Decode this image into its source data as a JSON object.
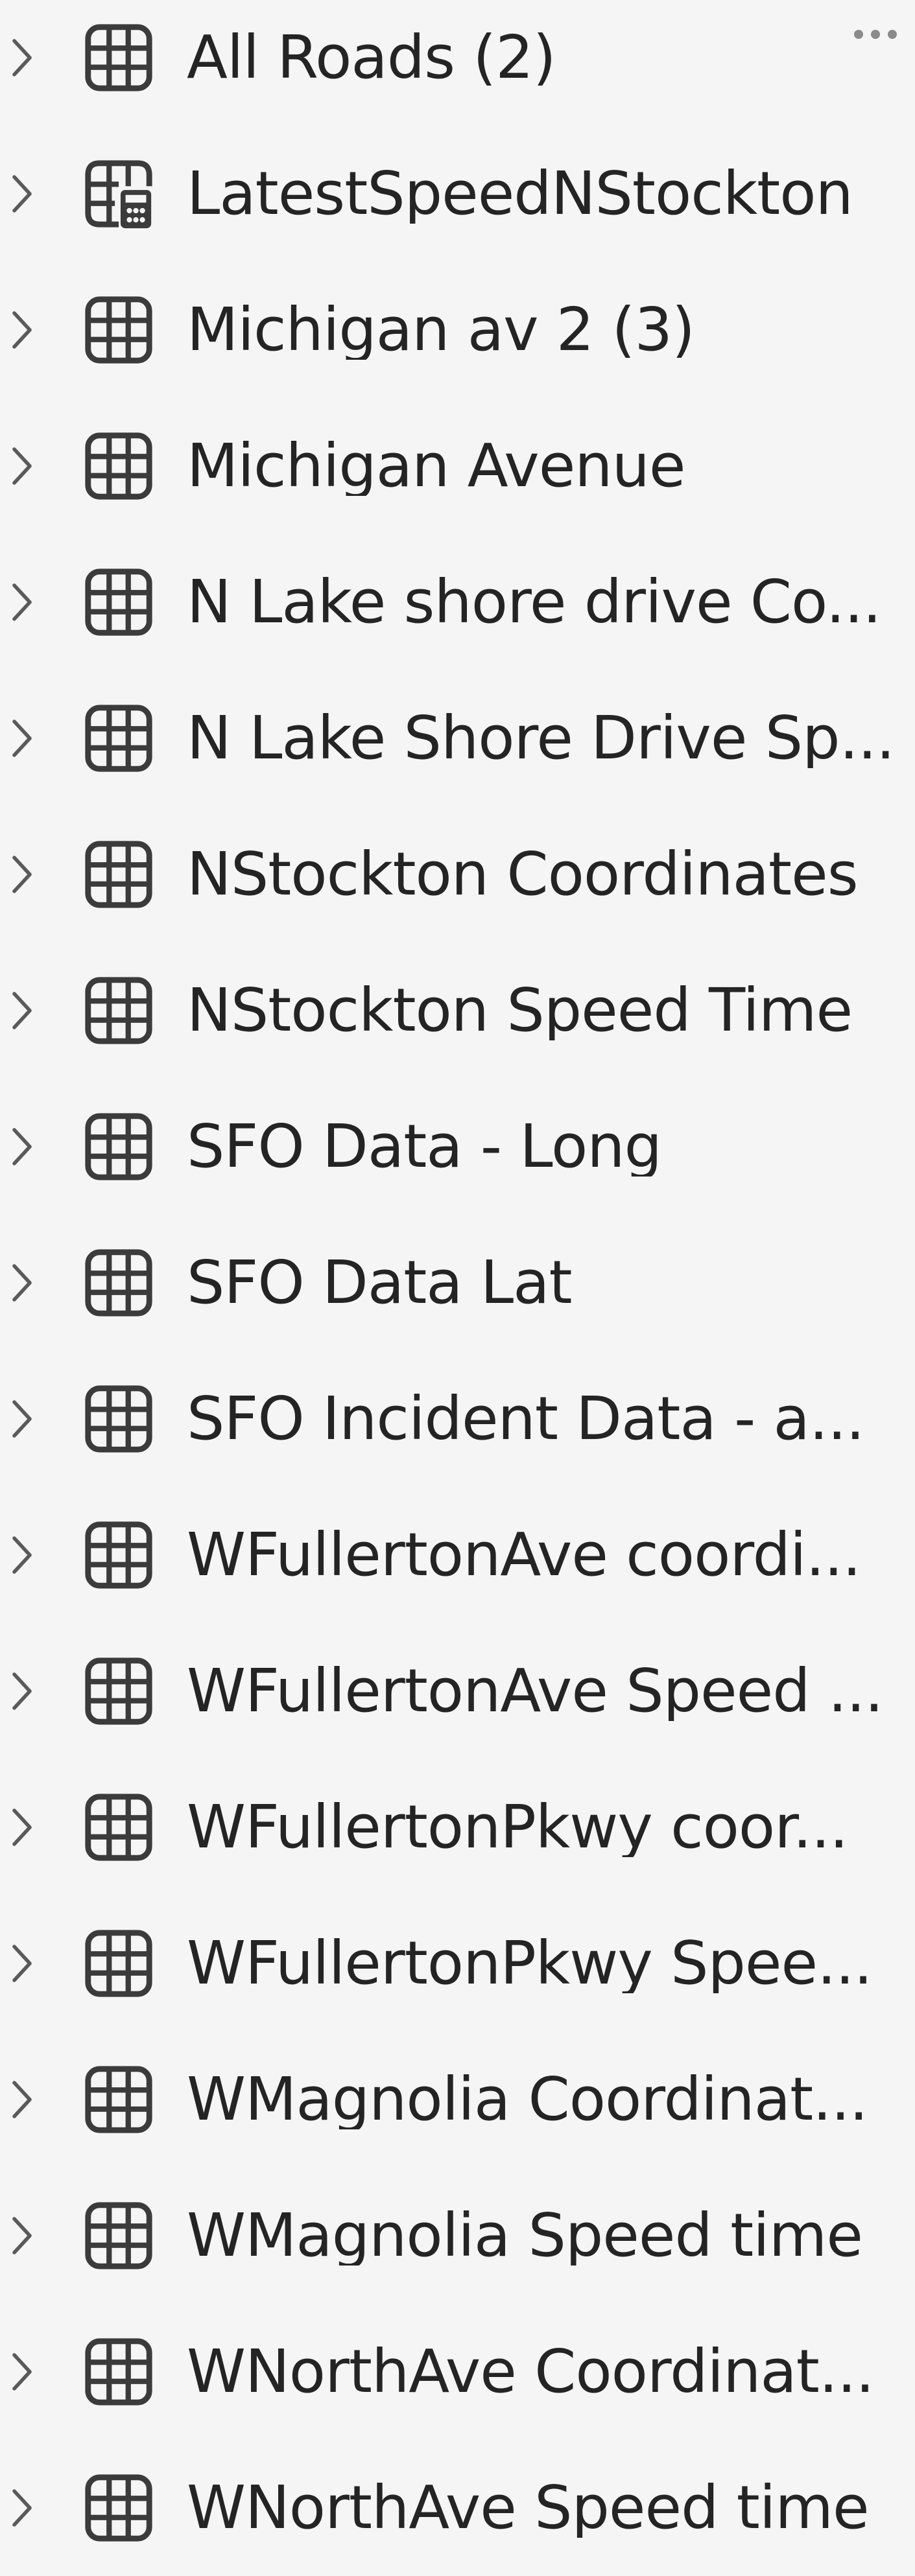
{
  "explorer": {
    "more_menu_label": "...",
    "items": [
      {
        "label": "All Roads (2)",
        "icon": "table-icon"
      },
      {
        "label": "LatestSpeedNStockton",
        "icon": "table-calculator-icon"
      },
      {
        "label": "Michigan av 2 (3)",
        "icon": "table-icon"
      },
      {
        "label": "Michigan Avenue",
        "icon": "table-icon"
      },
      {
        "label": "N Lake shore drive Co...",
        "icon": "table-icon"
      },
      {
        "label": "N Lake Shore Drive Sp...",
        "icon": "table-icon"
      },
      {
        "label": "NStockton Coordinates",
        "icon": "table-icon"
      },
      {
        "label": "NStockton Speed Time",
        "icon": "table-icon"
      },
      {
        "label": "SFO Data - Long",
        "icon": "table-icon"
      },
      {
        "label": "SFO Data Lat",
        "icon": "table-icon"
      },
      {
        "label": "SFO Incident Data - a...",
        "icon": "table-icon"
      },
      {
        "label": "WFullertonAve coordi...",
        "icon": "table-icon"
      },
      {
        "label": "WFullertonAve Speed ...",
        "icon": "table-icon"
      },
      {
        "label": "WFullertonPkwy coor...",
        "icon": "table-icon"
      },
      {
        "label": "WFullertonPkwy Spee...",
        "icon": "table-icon"
      },
      {
        "label": "WMagnolia Coordinat...",
        "icon": "table-icon"
      },
      {
        "label": "WMagnolia Speed time",
        "icon": "table-icon"
      },
      {
        "label": "WNorthAve Coordinat...",
        "icon": "table-icon"
      },
      {
        "label": "WNorthAve Speed time",
        "icon": "table-icon"
      }
    ]
  }
}
